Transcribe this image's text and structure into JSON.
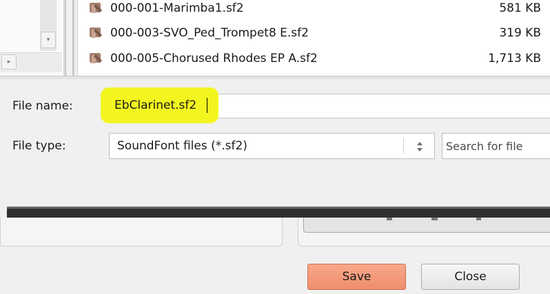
{
  "file_list": {
    "rows": [
      {
        "name": "000-001-Marimba1.sf2",
        "size": "581 KB"
      },
      {
        "name": "000-003-SVO_Ped_Trompet8 E.sf2",
        "size": "319 KB"
      },
      {
        "name": "000-005-Chorused Rhodes EP A.sf2",
        "size": "1,713 KB"
      }
    ]
  },
  "scroll": {
    "down_glyph": "▾",
    "right_glyph": "▸"
  },
  "form": {
    "file_name_label": "File name:",
    "file_name_value": "EbClarinet.sf2",
    "file_type_label": "File type:",
    "file_type_value": "SoundFont files (*.sf2)",
    "search_placeholder": "Search for file"
  },
  "buttons": {
    "save_label": "Save",
    "close_label": "Close"
  },
  "colors": {
    "highlight": "#f3f51e",
    "save_button": "#ef8e6c"
  },
  "icons": {
    "file": "soundfont-file-icon",
    "spin": "updown-arrows-icon"
  }
}
